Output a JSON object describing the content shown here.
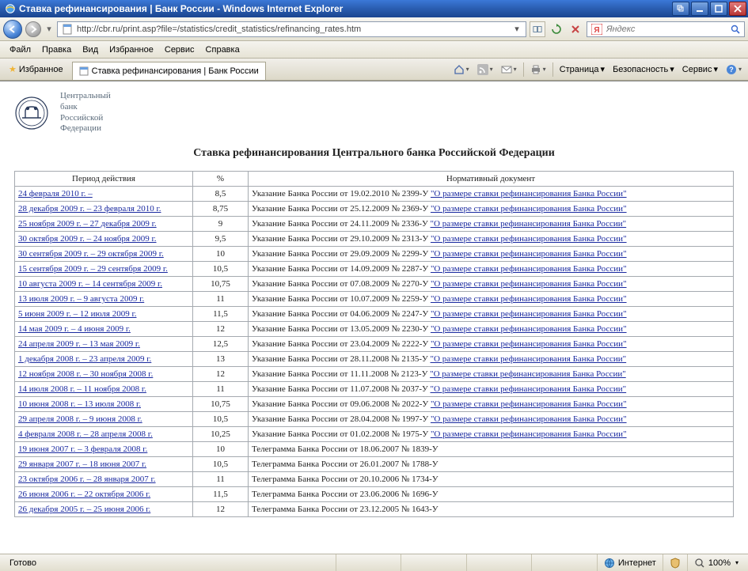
{
  "window": {
    "title": "Ставка рефинансирования | Банк России - Windows Internet Explorer"
  },
  "address": {
    "url": "http://cbr.ru/print.asp?file=/statistics/credit_statistics/refinancing_rates.htm"
  },
  "search": {
    "placeholder": "Яндекс"
  },
  "menu": {
    "file": "Файл",
    "edit": "Правка",
    "view": "Вид",
    "favorites": "Избранное",
    "service": "Сервис",
    "help": "Справка"
  },
  "cmdbar": {
    "favorites": "Избранное",
    "tab_title": "Ставка рефинансирования | Банк России",
    "page": "Страница",
    "safety": "Безопасность",
    "tools": "Сервис"
  },
  "page": {
    "bank_line1": "Центральный",
    "bank_line2": "банк",
    "bank_line3": "Российской",
    "bank_line4": "Федерации",
    "title": "Ставка рефинансирования Центрального банка Российской Федерации",
    "th_period": "Период действия",
    "th_rate": "%",
    "th_doc": "Нормативный документ",
    "rows": [
      {
        "period": "24 февраля 2010 г. –",
        "rate": "8,5",
        "doc_prefix": "Указание Банка России от 19.02.2010 № 2399-У ",
        "doc_link": "\"О размере ставки рефинансирования Банка России\""
      },
      {
        "period": "28 декабря  2009 г. – 23 февраля 2010 г.",
        "rate": "8,75",
        "doc_prefix": "Указание Банка России от 25.12.2009 № 2369-У ",
        "doc_link": "\"О размере ставки рефинансирования Банка России\""
      },
      {
        "period": "25 ноября 2009 г. – 27 декабря 2009 г.",
        "rate": "9",
        "doc_prefix": "Указание Банка России от 24.11.2009 № 2336-У ",
        "doc_link": "\"О размере ставки рефинансирования Банка России\""
      },
      {
        "period": "30 октября 2009 г. – 24 ноября 2009 г.",
        "rate": "9,5",
        "doc_prefix": "Указание Банка России от 29.10.2009 № 2313-У ",
        "doc_link": "\"О размере ставки рефинансирования Банка России\""
      },
      {
        "period": "30 сентября 2009 г. – 29 октября 2009 г.",
        "rate": "10",
        "doc_prefix": "Указание Банка России от 29.09.2009 № 2299-У ",
        "doc_link": "\"О размере ставки рефинансирования Банка России\""
      },
      {
        "period": "15 сентября 2009 г. – 29 сентября 2009 г.",
        "rate": "10,5",
        "doc_prefix": "Указание Банка России от 14.09.2009 № 2287-У ",
        "doc_link": "\"О размере ставки рефинансирования Банка России\""
      },
      {
        "period": "10 августа 2009 г. – 14 сентября 2009 г.",
        "rate": "10,75",
        "doc_prefix": "Указание Банка России от 07.08.2009 № 2270-У ",
        "doc_link": "\"О размере ставки рефинансирования Банка России\""
      },
      {
        "period": "13 июля 2009 г. – 9 августа 2009 г.",
        "rate": "11",
        "doc_prefix": "Указание Банка России от 10.07.2009 № 2259-У ",
        "doc_link": "\"О размере ставки рефинансирования Банка России\""
      },
      {
        "period": "5 июня 2009 г. – 12 июля 2009 г.",
        "rate": "11,5",
        "doc_prefix": "Указание Банка России от 04.06.2009 № 2247-У ",
        "doc_link": "\"О размере ставки рефинансирования Банка России\""
      },
      {
        "period": "14 мая 2009 г. – 4 июня 2009 г.",
        "rate": "12",
        "doc_prefix": "Указание Банка России от 13.05.2009 № 2230-У ",
        "doc_link": "\"О размере ставки рефинансирования Банка России\""
      },
      {
        "period": "24 апреля 2009 г. – 13 мая 2009 г.",
        "rate": "12,5",
        "doc_prefix": "Указание Банка России от 23.04.2009 № 2222-У ",
        "doc_link": "\"О размере ставки рефинансирования Банка России\""
      },
      {
        "period": "1 декабря 2008 г. – 23 апреля 2009 г.",
        "rate": "13",
        "doc_prefix": "Указание Банка России от 28.11.2008 № 2135-У ",
        "doc_link": "\"О размере ставки рефинансирования Банка России\""
      },
      {
        "period": "12 ноября 2008 г. – 30 ноября 2008 г.",
        "rate": "12",
        "doc_prefix": "Указание Банка России от 11.11.2008 № 2123-У ",
        "doc_link": "\"О размере ставки рефинансирования Банка России\""
      },
      {
        "period": "14 июля 2008 г. – 11 ноября 2008 г.",
        "rate": "11",
        "doc_prefix": "Указание Банка России от 11.07.2008 № 2037-У ",
        "doc_link": "\"О размере ставки рефинансирования Банка России\""
      },
      {
        "period": "10 июня 2008 г. – 13 июля 2008 г.",
        "rate": "10,75",
        "doc_prefix": "Указание Банка России от 09.06.2008 № 2022-У ",
        "doc_link": "\"О размере ставки рефинансирования Банка России\""
      },
      {
        "period": "29 апреля 2008 г. – 9 июня 2008 г.",
        "rate": "10,5",
        "doc_prefix": "Указание Банка России от 28.04.2008 № 1997-У ",
        "doc_link": "\"О размере ставки рефинансирования Банка России\""
      },
      {
        "period": "4 февраля 2008 г. – 28 апреля 2008 г.",
        "rate": "10,25",
        "doc_prefix": "Указание Банка России от 01.02.2008 № 1975-У ",
        "doc_link": "\"О размере ставки рефинансирования Банка России\""
      },
      {
        "period": "19 июня 2007 г. – 3 февраля 2008 г.",
        "rate": "10",
        "doc_prefix": "Телеграмма Банка России от 18.06.2007 № 1839-У",
        "doc_link": ""
      },
      {
        "period": "29 января 2007 г. – 18 июня 2007 г.",
        "rate": "10,5",
        "doc_prefix": "Телеграмма Банка России от 26.01.2007 № 1788-У",
        "doc_link": ""
      },
      {
        "period": "23 октября 2006 г. – 28 января 2007 г.",
        "rate": "11",
        "doc_prefix": "Телеграмма Банка России от 20.10.2006 № 1734-У",
        "doc_link": ""
      },
      {
        "period": "26 июня 2006 г. – 22 октября 2006 г.",
        "rate": "11,5",
        "doc_prefix": "Телеграмма Банка России от 23.06.2006 № 1696-У",
        "doc_link": ""
      },
      {
        "period": "26 декабря 2005 г. – 25 июня 2006 г.",
        "rate": "12",
        "doc_prefix": "Телеграмма Банка России от 23.12.2005 № 1643-У",
        "doc_link": ""
      }
    ]
  },
  "status": {
    "ready": "Готово",
    "zone": "Интернет",
    "zoom": "100%"
  }
}
